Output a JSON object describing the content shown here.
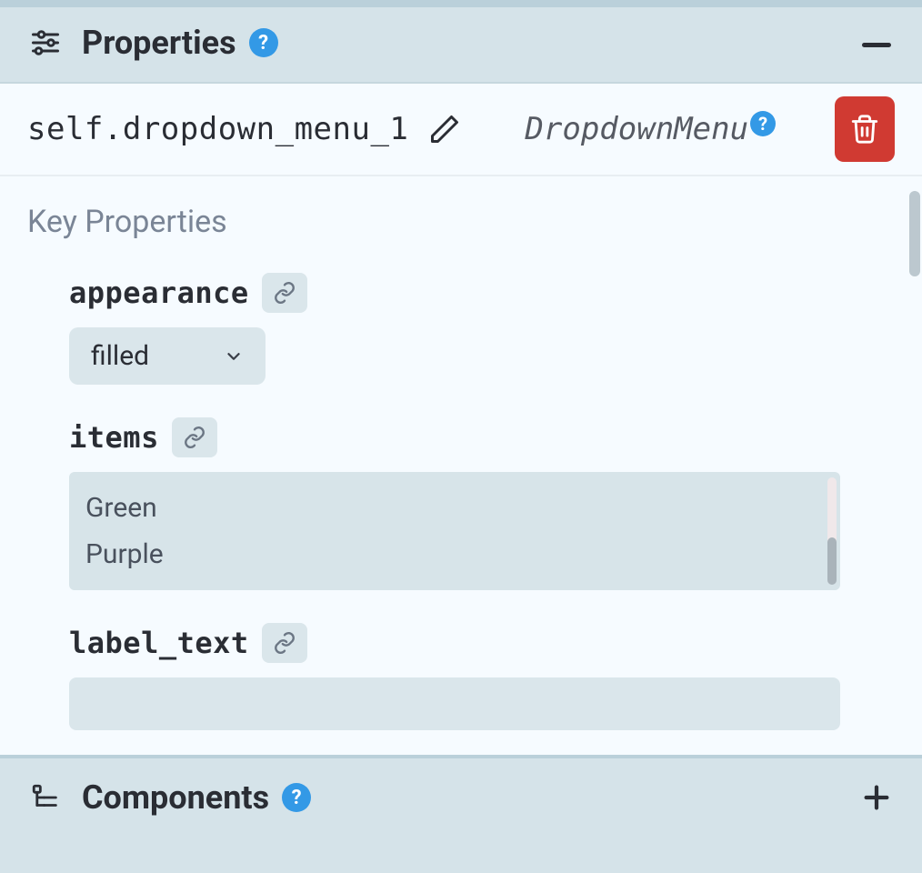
{
  "panels": {
    "properties": {
      "title": "Properties",
      "help": "?"
    },
    "components": {
      "title": "Components",
      "help": "?"
    }
  },
  "component": {
    "name": "self.dropdown_menu_1",
    "type": "DropdownMenu",
    "type_help": "?"
  },
  "key_properties": {
    "section_label": "Key Properties",
    "appearance": {
      "label": "appearance",
      "value": "filled"
    },
    "items": {
      "label": "items",
      "values": [
        "Green",
        "Purple"
      ]
    },
    "label_text": {
      "label": "label_text",
      "value": ""
    }
  }
}
